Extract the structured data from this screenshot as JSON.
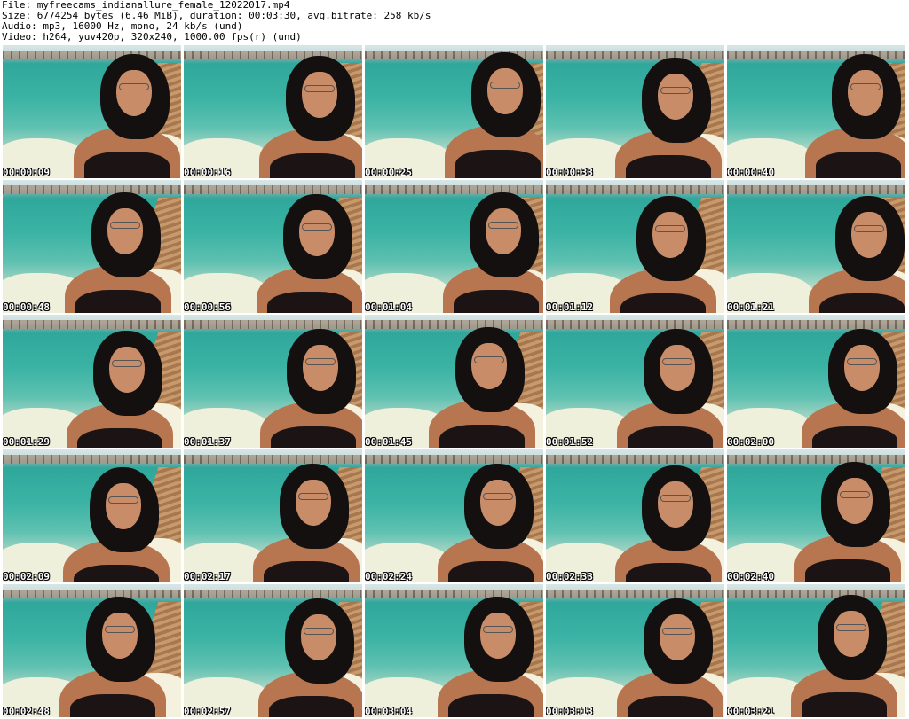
{
  "header": {
    "file_line": "File: myfreecams_indianallure_female_12022017.mp4",
    "size_line": "Size: 6774254 bytes (6.46 MiB), duration: 00:03:30, avg.bitrate: 258 kb/s",
    "audio_line": "Audio: mp3, 16000 Hz, mono, 24 kb/s (und)",
    "video_line": "Video: h264, yuv420p, 320x240, 1000.00 fps(r) (und)"
  },
  "thumbnails": [
    {
      "timestamp": "00:00:09"
    },
    {
      "timestamp": "00:00:16"
    },
    {
      "timestamp": "00:00:25"
    },
    {
      "timestamp": "00:00:33"
    },
    {
      "timestamp": "00:00:40"
    },
    {
      "timestamp": "00:00:48"
    },
    {
      "timestamp": "00:00:56"
    },
    {
      "timestamp": "00:01:04"
    },
    {
      "timestamp": "00:01:12"
    },
    {
      "timestamp": "00:01:21"
    },
    {
      "timestamp": "00:01:29"
    },
    {
      "timestamp": "00:01:37"
    },
    {
      "timestamp": "00:01:45"
    },
    {
      "timestamp": "00:01:52"
    },
    {
      "timestamp": "00:02:00"
    },
    {
      "timestamp": "00:02:09"
    },
    {
      "timestamp": "00:02:17"
    },
    {
      "timestamp": "00:02:24"
    },
    {
      "timestamp": "00:02:33"
    },
    {
      "timestamp": "00:02:40"
    },
    {
      "timestamp": "00:02:48"
    },
    {
      "timestamp": "00:02:57"
    },
    {
      "timestamp": "00:03:04"
    },
    {
      "timestamp": "00:03:13"
    },
    {
      "timestamp": "00:03:21"
    }
  ]
}
